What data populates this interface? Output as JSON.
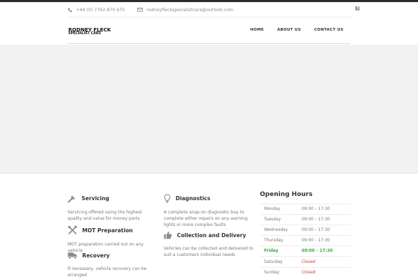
{
  "header": {
    "phone": "+44 (0) 7762 870 675",
    "email": "rodneyfleckspecialistcars@outlook.com",
    "social_icon": "facebook-icon",
    "logo_line1": "RODNEY FLECK",
    "logo_line2": "SPECIALIST CARS"
  },
  "nav": {
    "home": "HOME",
    "about": "ABOUT US",
    "contact": "CONTACT US"
  },
  "services": {
    "servicing": {
      "title": "Servicing",
      "desc": "Servicing offered using the highest quality and value for money parts"
    },
    "diagnostics": {
      "title": "Diagnostics",
      "desc": "A complete snap-on diagnostic bay to complete either repairs on any warning lights or more complex faults"
    },
    "mot": {
      "title": "MOT Preparation",
      "desc": "MOT preparation carried out on any vehicle"
    },
    "collection": {
      "title": "Collection and Delivery",
      "desc": "Vehicles can be collected and delivered to suit a customers individual needs"
    },
    "recovery": {
      "title": "Recovery",
      "desc": "If necessary, vehicle recovery can be arranged"
    }
  },
  "hours": {
    "title": "Opening Hours",
    "rows": [
      {
        "day": "Monday",
        "time": "09:00 – 17:30"
      },
      {
        "day": "Tuesday",
        "time": "09:00 – 17:30"
      },
      {
        "day": "Wednesday",
        "time": "09:00 – 17:30"
      },
      {
        "day": "Thursday",
        "time": "09:00 – 17:30"
      },
      {
        "day": "Friday",
        "time": "09:00 – 17:30"
      },
      {
        "day": "Saturday",
        "time": "Closed"
      },
      {
        "day": "Sunday",
        "time": "Closed"
      }
    ]
  },
  "colors": {
    "today": "#39a63c",
    "closed": "#d33b2f",
    "hero": "#f2f2f2"
  }
}
